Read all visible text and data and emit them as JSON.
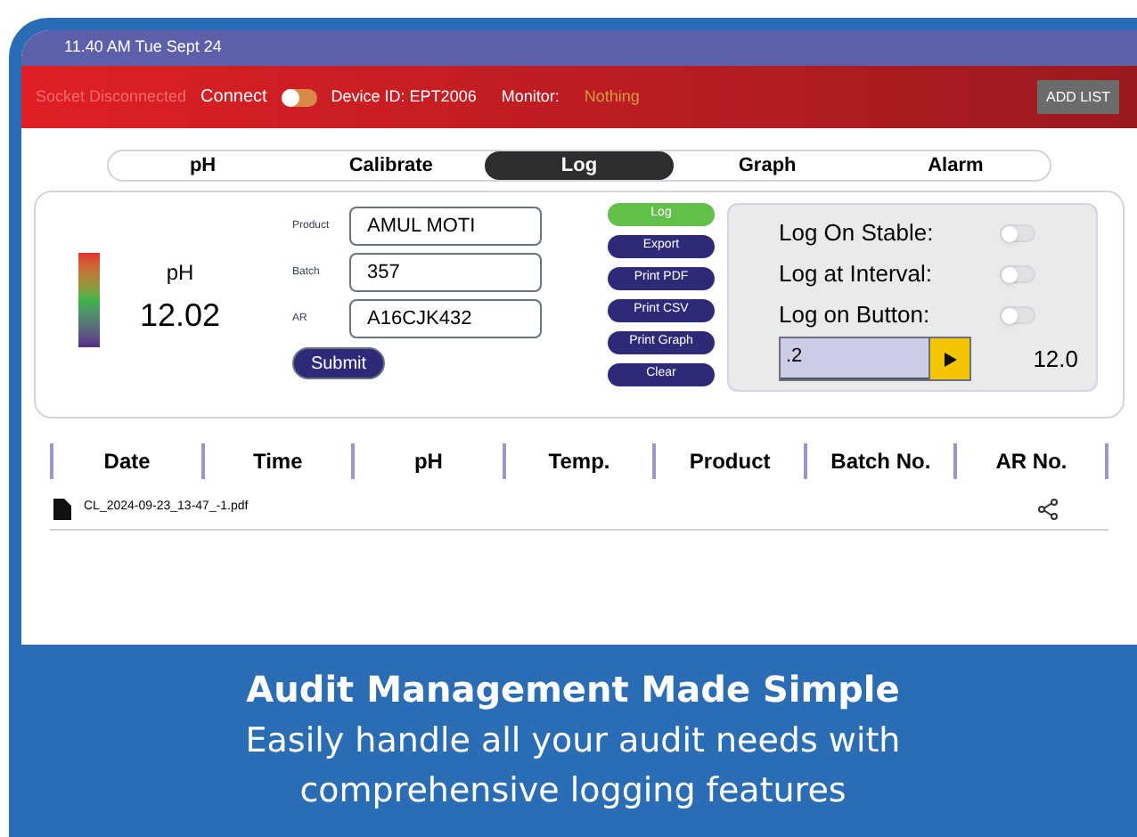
{
  "status_bar": {
    "time": "11.40 AM Tue Sept 24"
  },
  "header": {
    "socket_status": "Socket Disconnected",
    "connect_label": "Connect",
    "connect_on": false,
    "device_id": "Device ID: EPT2006",
    "monitor_label": "Monitor:",
    "monitor_value": "Nothing",
    "add_button": "ADD LIST"
  },
  "tabs": [
    {
      "label": "pH",
      "selected": false
    },
    {
      "label": "Calibrate",
      "selected": false
    },
    {
      "label": "Log",
      "selected": true
    },
    {
      "label": "Graph",
      "selected": false
    },
    {
      "label": "Alarm",
      "selected": false
    }
  ],
  "reading": {
    "label": "pH",
    "value": "12.02"
  },
  "fields": [
    {
      "label": "Product",
      "value": "AMUL MOTI"
    },
    {
      "label": "Batch",
      "value": "357"
    },
    {
      "label": "AR",
      "value": "A16CJK432"
    }
  ],
  "submit_button": "Submit",
  "action_buttons": [
    {
      "label": "Log",
      "selected": true
    },
    {
      "label": "Export",
      "selected": false
    },
    {
      "label": "Print PDF",
      "selected": false
    },
    {
      "label": "Print CSV",
      "selected": false
    },
    {
      "label": "Print Graph",
      "selected": false
    },
    {
      "label": "Clear",
      "selected": false
    }
  ],
  "log_options": [
    {
      "label": "Log On Stable:",
      "on": false
    },
    {
      "label": "Log at Interval:",
      "on": false
    },
    {
      "label": "Log on Button:",
      "on": false
    }
  ],
  "interval": {
    "value": ".2",
    "reading": "12.0"
  },
  "table": {
    "columns": [
      "Date",
      "Time",
      "pH",
      "Temp.",
      "Product",
      "Batch No.",
      "AR No."
    ],
    "files": [
      {
        "name": "CL_2024-09-23_13-47_-1.pdf"
      }
    ]
  },
  "caption": {
    "title": "Audit Management Made Simple",
    "text": "Easily handle all your audit needs with comprehensive logging features"
  }
}
